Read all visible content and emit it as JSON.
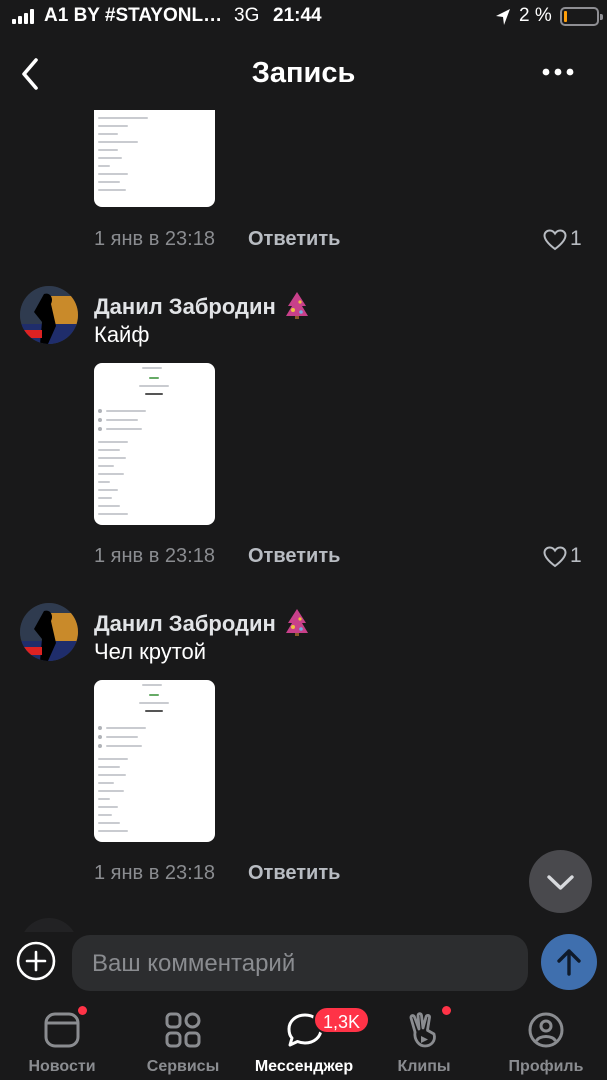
{
  "status_bar": {
    "carrier": "A1 BY #STAYONL…",
    "network": "3G",
    "time": "21:44",
    "battery": "2 %"
  },
  "header": {
    "title": "Запись"
  },
  "comments": [
    {
      "date": "1 янв в 23:18",
      "reply": "Ответить",
      "likes": "1"
    },
    {
      "author": "Данил Забродин",
      "text": "Кайф",
      "date": "1 янв в 23:18",
      "reply": "Ответить",
      "likes": "1"
    },
    {
      "author": "Данил Забродин",
      "text": "Чел крутой",
      "date": "1 янв в 23:18",
      "reply": "Ответить"
    }
  ],
  "composer": {
    "placeholder": "Ваш комментарий"
  },
  "tabbar": {
    "tabs": [
      {
        "label": "Новости",
        "icon": "news-icon"
      },
      {
        "label": "Сервисы",
        "icon": "services-icon"
      },
      {
        "label": "Мессенджер",
        "icon": "messenger-icon"
      },
      {
        "label": "Клипы",
        "icon": "clips-icon"
      },
      {
        "label": "Профиль",
        "icon": "profile-icon"
      }
    ],
    "messenger_badge": "1,3K",
    "active_tab": "Мессенджер"
  },
  "colors": {
    "background": "#19191a",
    "accent": "#3f6fae",
    "badge": "#ff3347"
  }
}
